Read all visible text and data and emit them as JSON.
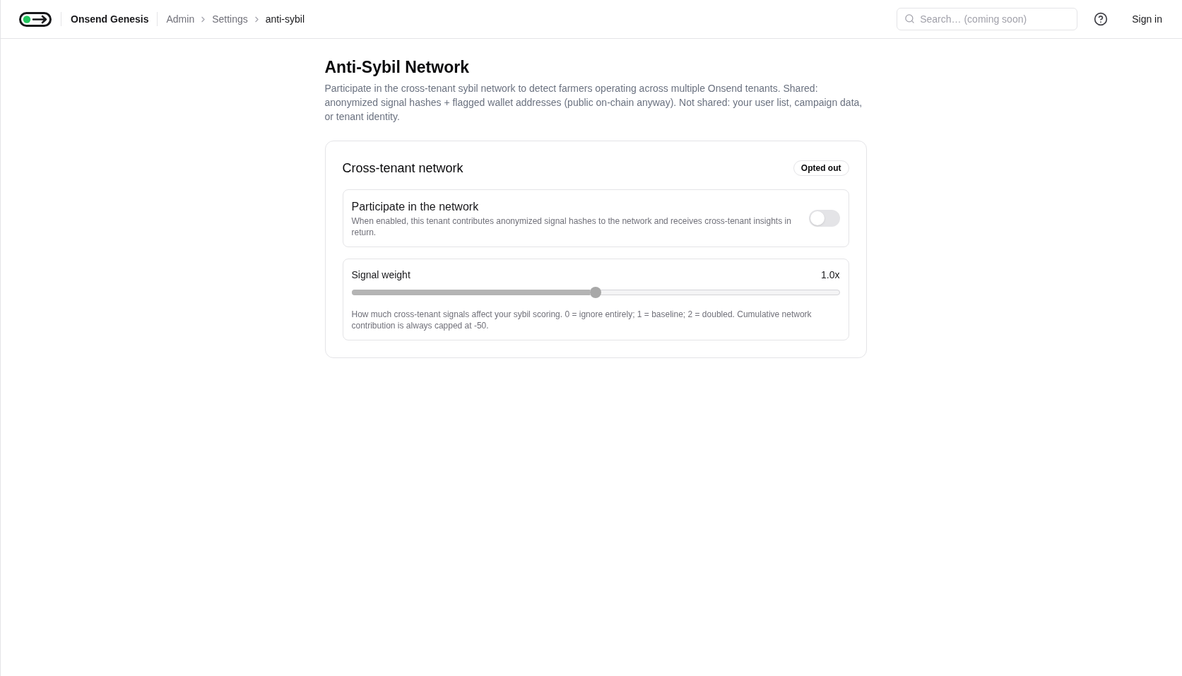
{
  "header": {
    "brand": "Onsend Genesis",
    "breadcrumbs": [
      {
        "label": "Admin",
        "current": false
      },
      {
        "label": "Settings",
        "current": false
      },
      {
        "label": "anti-sybil",
        "current": true
      }
    ],
    "search": {
      "placeholder": "Search… (coming soon)"
    },
    "sign_in": "Sign in"
  },
  "page": {
    "title": "Anti-Sybil Network",
    "description": "Participate in the cross-tenant sybil network to detect farmers operating across multiple Onsend tenants. Shared: anonymized signal hashes + flagged wallet addresses (public on-chain anyway). Not shared: your user list, campaign data, or tenant identity."
  },
  "card": {
    "title": "Cross-tenant network",
    "badge": "Opted out",
    "settings": [
      {
        "kind": "toggle",
        "label": "Participate in the network",
        "description": "When enabled, this tenant contributes anonymized signal hashes to the network and receives cross-tenant insights in return.",
        "on": false
      },
      {
        "kind": "slider",
        "label": "Signal weight",
        "reading": "1.0x",
        "level": 0.5,
        "description": "How much cross-tenant signals affect your sybil scoring. 0 = ignore entirely; 1 = baseline; 2 = doubled. Cumulative network contribution is always capped at -50."
      }
    ]
  }
}
